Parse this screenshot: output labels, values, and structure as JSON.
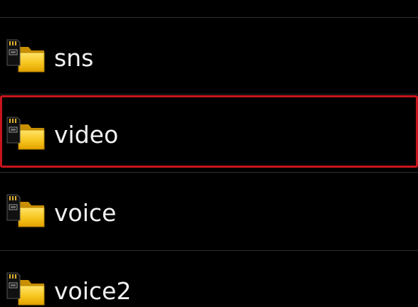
{
  "file_list": {
    "items": [
      {
        "name": "sns",
        "icon": "sd-card-folder-icon",
        "selected": false
      },
      {
        "name": "video",
        "icon": "sd-card-folder-icon",
        "selected": true
      },
      {
        "name": "voice",
        "icon": "sd-card-folder-icon",
        "selected": false
      },
      {
        "name": "voice2",
        "icon": "sd-card-folder-icon",
        "selected": false
      }
    ]
  },
  "colors": {
    "background": "#000000",
    "text": "#f2f2f2",
    "divider": "#2e2e2e",
    "selection_border": "#c8141c",
    "folder_yellow": "#f7c51e",
    "sd_card": "#111111"
  }
}
